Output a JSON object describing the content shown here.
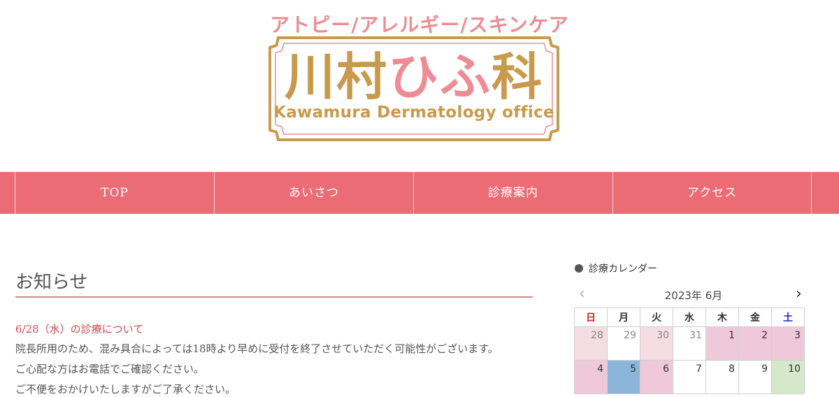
{
  "header": {
    "tagline": "アトピー/アレルギー/スキンケア",
    "logo_gold": "川村",
    "logo_pink": "ひふ",
    "logo_gold2": "科",
    "logo_sub": "Kawamura Dermatology office"
  },
  "nav": {
    "items": [
      {
        "label": "TOP"
      },
      {
        "label": "あいさつ"
      },
      {
        "label": "診療案内"
      },
      {
        "label": "アクセス"
      }
    ]
  },
  "news": {
    "title": "お知らせ",
    "headline": "6/28（水）の診療について",
    "lines": [
      "院長所用のため、混み具合によっては18時より早めに受付を終了させていただく可能性がございます。",
      "ご心配な方はお電話でご確認ください。",
      "ご不便をおかけいたしますがご了承ください。"
    ]
  },
  "calendar": {
    "title": "診療カレンダー",
    "month": "2023年 6月",
    "prev_icon": "chevron-left-icon",
    "next_icon": "chevron-right-icon",
    "weekdays": [
      "日",
      "月",
      "火",
      "水",
      "木",
      "金",
      "土"
    ],
    "colors": {
      "pink": "#efc9d9",
      "pink_light": "#f5dde4",
      "blue": "#8db5d9",
      "green": "#d5e8c9",
      "white": "#ffffff"
    },
    "weeks": [
      [
        {
          "day": "28",
          "bg": "pink_light",
          "other": true
        },
        {
          "day": "29",
          "bg": "white",
          "other": true
        },
        {
          "day": "30",
          "bg": "pink_light",
          "other": true
        },
        {
          "day": "31",
          "bg": "white",
          "other": true
        },
        {
          "day": "1",
          "bg": "pink",
          "other": false
        },
        {
          "day": "2",
          "bg": "pink",
          "other": false
        },
        {
          "day": "3",
          "bg": "pink",
          "other": false
        }
      ],
      [
        {
          "day": "4",
          "bg": "pink",
          "other": false
        },
        {
          "day": "5",
          "bg": "blue",
          "other": false
        },
        {
          "day": "6",
          "bg": "pink",
          "other": false
        },
        {
          "day": "7",
          "bg": "white",
          "other": false
        },
        {
          "day": "8",
          "bg": "white",
          "other": false
        },
        {
          "day": "9",
          "bg": "white",
          "other": false
        },
        {
          "day": "10",
          "bg": "green",
          "other": false
        }
      ]
    ]
  }
}
